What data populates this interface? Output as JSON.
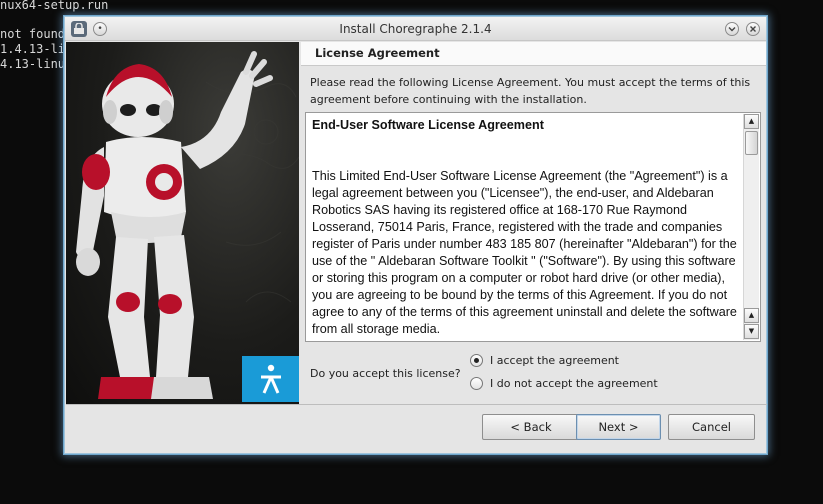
{
  "terminal": {
    "lines": [
      "nux64-setup.run",
      "not found",
      "1.4.13-li",
      "4.13-linu"
    ]
  },
  "window": {
    "title": "Install Choregraphe 2.1.4"
  },
  "page": {
    "header": "License Agreement",
    "intro": "Please read the following License Agreement. You must accept the terms of this agreement before continuing with the installation."
  },
  "license": {
    "heading": "End-User Software License Agreement",
    "body": "This Limited End-User Software License Agreement (the \"Agreement\") is a legal agreement between you (\"Licensee\"), the end-user, and Aldebaran Robotics SAS having its registered office at 168-170 Rue Raymond Losserand, 75014 Paris, France, registered with the trade and companies register of Paris under number 483 185 807 (hereinafter \"Aldebaran\") for the use of the \" Aldebaran Software Toolkit \" (\"Software\"). By using this software or storing this program on a computer or robot hard drive (or other media), you are agreeing to be bound by the terms of this Agreement. If you do not agree to any of the terms of this agreement uninstall and delete the software from all storage media."
  },
  "acceptance": {
    "question": "Do you accept this license?",
    "options": [
      {
        "label": "I accept the agreement",
        "selected": true
      },
      {
        "label": "I do not accept the agreement",
        "selected": false
      }
    ]
  },
  "buttons": {
    "back": "< Back",
    "next": "Next >",
    "cancel": "Cancel"
  },
  "colors": {
    "logo_blue": "#1a9bd7",
    "robot_red": "#b8102a"
  },
  "icons": {
    "window_icon": "installer-icon",
    "left_button": "pin-icon",
    "minimize": "chevron-down-icon",
    "close": "close-icon",
    "logo": "aldebaran-logo-icon"
  }
}
